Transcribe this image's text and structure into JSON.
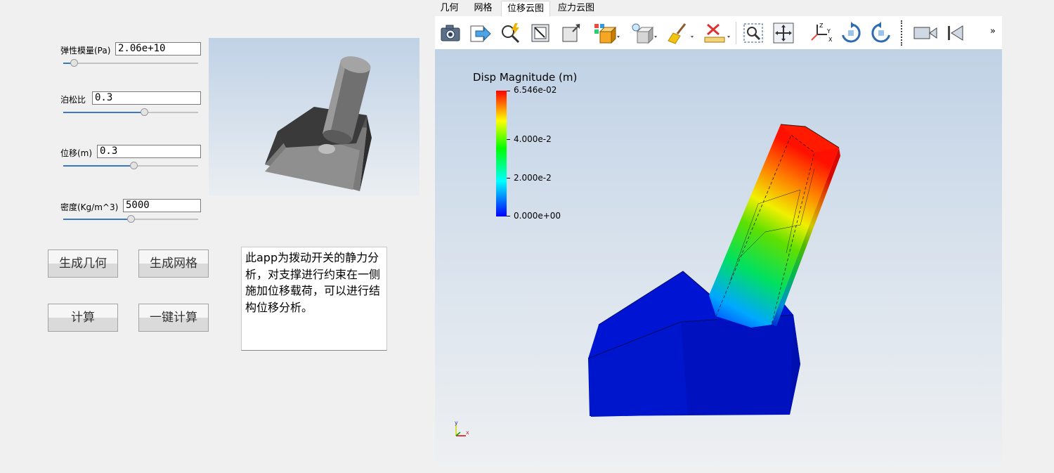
{
  "params": {
    "youngs": {
      "label": "弹性模量(Pa)",
      "value": "2.06e+10",
      "slider": 0.08
    },
    "poisson": {
      "label": "泊松比",
      "value": "0.3",
      "slider": 0.6
    },
    "displacement": {
      "label": "位移(m)",
      "value": "0.3",
      "slider": 0.52
    },
    "density": {
      "label": "密度(Kg/m^3)",
      "value": "5000",
      "slider": 0.5
    }
  },
  "buttons": {
    "gen_geometry": "生成几何",
    "gen_mesh": "生成网格",
    "compute": "计算",
    "one_click": "一键计算"
  },
  "description": "此app为拨动开关的静力分析，对支撑进行约束在一侧施加位移载荷，可以进行结构位移分析。",
  "tabs": [
    {
      "label": "几何",
      "active": false
    },
    {
      "label": "网格",
      "active": false
    },
    {
      "label": "位移云图",
      "active": true
    },
    {
      "label": "应力云图",
      "active": false
    }
  ],
  "toolbar": {
    "icons": [
      "camera-icon",
      "export-icon",
      "zoom-lightning-icon",
      "zoom-box-icon",
      "reset-view-icon",
      "colored-cube-icon",
      "light-cube-icon",
      "brush-icon",
      "ruler-delete-icon",
      "zoom-select-icon",
      "pan-icon",
      "axes-icon",
      "rotate-cw-icon",
      "rotate-ccw-icon",
      "camera-link-icon",
      "first-frame-icon"
    ],
    "overflow": "»"
  },
  "scalar_bar": {
    "title": "Disp Magnitude (m)",
    "ticks": [
      "6.546e-02",
      "4.000e-2",
      "2.000e-2",
      "0.000e+00"
    ]
  },
  "axes_triad": {
    "y": "y",
    "x": "x"
  },
  "colors": {
    "accent": "#3a78c6",
    "colormap": [
      "#0000ff",
      "#00ffff",
      "#00ff00",
      "#ffff00",
      "#ff0000"
    ]
  }
}
